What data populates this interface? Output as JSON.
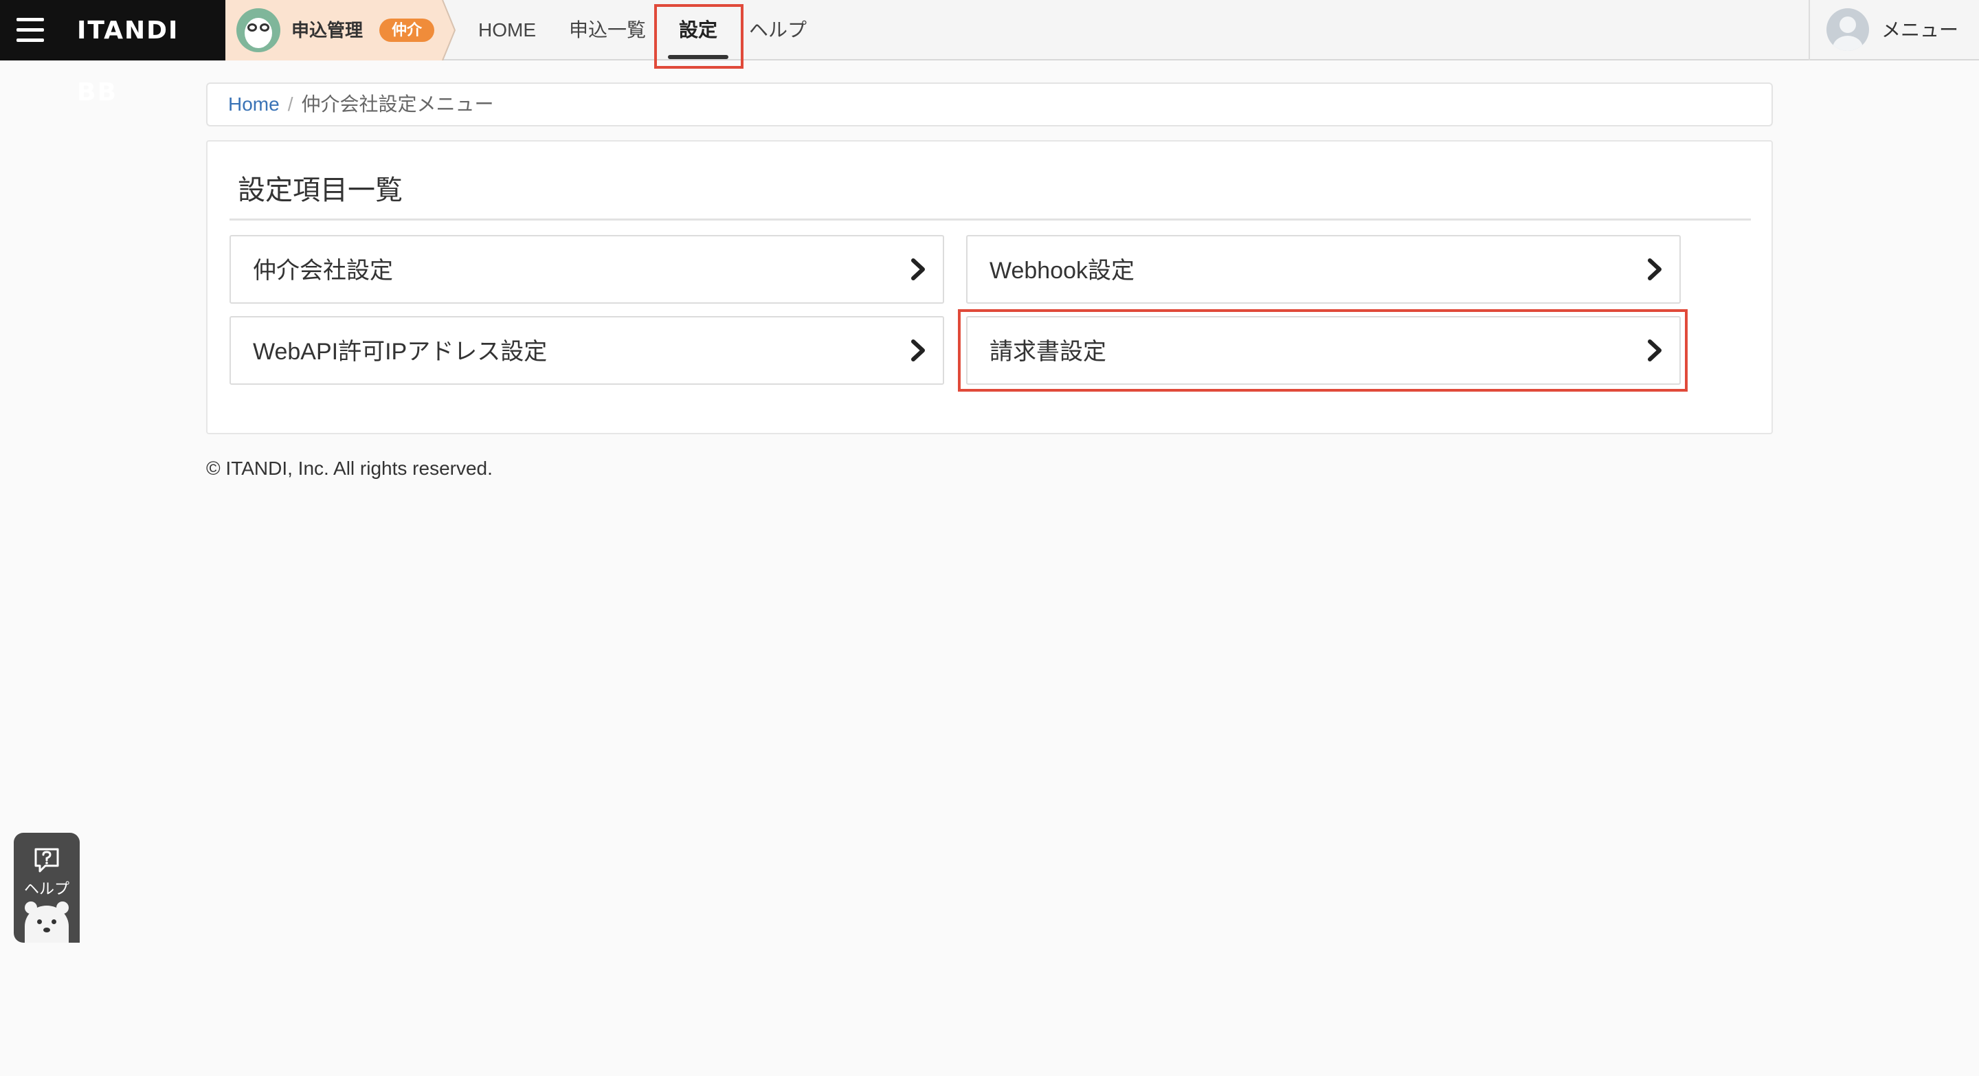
{
  "header": {
    "brand": "ITANDI BB",
    "app_name": "申込管理",
    "app_badge": "仲介",
    "nav": {
      "home": "HOME",
      "applications": "申込一覧",
      "settings": "設定",
      "help": "ヘルプ"
    },
    "active_tab": "設定",
    "user_menu": "メニュー"
  },
  "breadcrumb": {
    "home": "Home",
    "separator": "/",
    "current": "仲介会社設定メニュー"
  },
  "panel": {
    "title": "設定項目一覧",
    "items": [
      {
        "label": "仲介会社設定",
        "icon": "chevron-right-icon"
      },
      {
        "label": "Webhook設定",
        "icon": "chevron-right-icon"
      },
      {
        "label": "WebAPI許可IPアドレス設定",
        "icon": "chevron-right-icon"
      },
      {
        "label": "請求書設定",
        "icon": "chevron-right-icon"
      }
    ]
  },
  "footer": {
    "copyright": "© ITANDI, Inc. All rights reserved."
  },
  "help_widget": {
    "label": "ヘルプ",
    "icon": "question-bubble-icon"
  },
  "colors": {
    "brand_bg": "#111111",
    "app_chip_bg": "#fbe3d0",
    "badge": "#f08c3a",
    "link": "#3a73b6",
    "highlight_box": "#e04a3a",
    "page_bg": "#fafafa"
  }
}
